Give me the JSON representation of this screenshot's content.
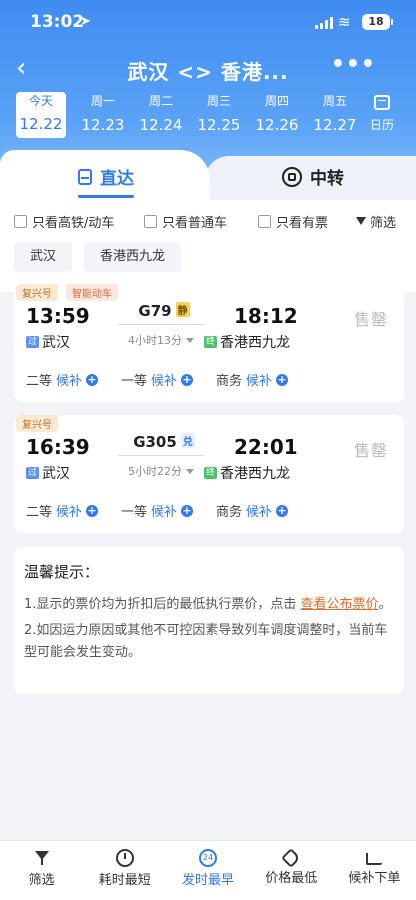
{
  "status": {
    "time": "13:02",
    "battery": "18"
  },
  "nav": {
    "title": "武汉 <> 香港...",
    "more": "•••"
  },
  "dates": [
    {
      "weekday": "今天",
      "date": "12.22",
      "active": true
    },
    {
      "weekday": "周一",
      "date": "12.23"
    },
    {
      "weekday": "周二",
      "date": "12.24"
    },
    {
      "weekday": "周三",
      "date": "12.25"
    },
    {
      "weekday": "周四",
      "date": "12.26"
    },
    {
      "weekday": "周五",
      "date": "12.27"
    }
  ],
  "calendar_label": "日历",
  "tabs": {
    "direct": "直达",
    "transfer": "中转"
  },
  "filters": {
    "high_speed": "只看高铁/动车",
    "normal": "只看普通车",
    "available": "只看有票",
    "sort": "筛选"
  },
  "stations": {
    "from": "武汉",
    "to": "香港西九龙"
  },
  "trains": [
    {
      "tags": [
        "复兴号",
        "智能动车"
      ],
      "dep_time": "13:59",
      "arr_time": "18:12",
      "train_no": "G79",
      "mark": "静",
      "duration": "4小时13分",
      "dep_station": "武汉",
      "dep_pill": "过",
      "arr_station": "香港西九龙",
      "arr_pill": "终",
      "status": "售罄",
      "seats": [
        {
          "class": "二等",
          "action": "候补"
        },
        {
          "class": "一等",
          "action": "候补"
        },
        {
          "class": "商务",
          "action": "候补"
        }
      ]
    },
    {
      "tags": [
        "复兴号"
      ],
      "dep_time": "16:39",
      "arr_time": "22:01",
      "train_no": "G305",
      "mark": "兑",
      "duration": "5小时22分",
      "dep_station": "武汉",
      "dep_pill": "过",
      "arr_station": "香港西九龙",
      "arr_pill": "终",
      "status": "售罄",
      "seats": [
        {
          "class": "二等",
          "action": "候补"
        },
        {
          "class": "一等",
          "action": "候补"
        },
        {
          "class": "商务",
          "action": "候补"
        }
      ]
    }
  ],
  "tips": {
    "title": "温馨提示：",
    "line1_prefix": "1.显示的票价均为折扣后的最低执行票价，点击 ",
    "line1_link": "查看公布票价",
    "line1_suffix": "。",
    "line2": "2.如因运力原因或其他不可控因素导致列车调度调整时，当前车型可能会发生变动。"
  },
  "bottom_bar": [
    {
      "label": "筛选",
      "icon": "filter-icon"
    },
    {
      "label": "耗时最短",
      "icon": "clock-icon"
    },
    {
      "label": "发时最早",
      "icon": "24h-icon",
      "active": true
    },
    {
      "label": "价格最低",
      "icon": "price-tag-icon"
    },
    {
      "label": "候补下单",
      "icon": "cart-icon"
    }
  ]
}
